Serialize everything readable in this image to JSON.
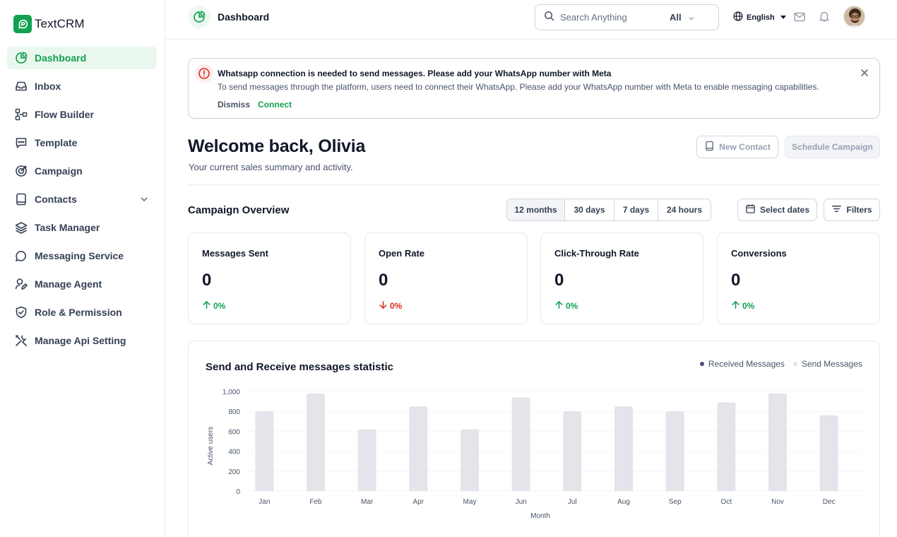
{
  "app": {
    "name": "TextCRM"
  },
  "sidebar": {
    "items": [
      {
        "label": "Dashboard",
        "icon": "dashboard-icon",
        "active": true
      },
      {
        "label": "Inbox",
        "icon": "inbox-icon"
      },
      {
        "label": "Flow Builder",
        "icon": "flow-builder-icon"
      },
      {
        "label": "Template",
        "icon": "template-icon"
      },
      {
        "label": "Campaign",
        "icon": "campaign-icon"
      },
      {
        "label": "Contacts",
        "icon": "contacts-icon",
        "expandable": true
      },
      {
        "label": "Task Manager",
        "icon": "task-manager-icon"
      },
      {
        "label": "Messaging Service",
        "icon": "messaging-service-icon"
      },
      {
        "label": "Manage Agent",
        "icon": "manage-agent-icon"
      },
      {
        "label": "Role & Permission",
        "icon": "role-permission-icon"
      },
      {
        "label": "Manage Api Setting",
        "icon": "api-setting-icon"
      }
    ]
  },
  "header": {
    "title": "Dashboard",
    "search_placeholder": "Search Anything",
    "search_scope": "All",
    "language": "English"
  },
  "alert": {
    "title": "Whatsapp connection is needed to send messages. Please add your WhatsApp number with Meta",
    "body": "To send messages through the platform, users need to connect their WhatsApp. Please add your WhatsApp number with Meta to enable messaging capabilities.",
    "dismiss_label": "Dismiss",
    "connect_label": "Connect"
  },
  "welcome": {
    "title": "Welcome back, Olivia",
    "subtitle": "Your current sales summary and activity.",
    "new_contact_label": "New Contact",
    "schedule_label": "Schedule Campaign"
  },
  "overview": {
    "title": "Campaign Overview",
    "ranges": [
      "12 months",
      "30 days",
      "7 days",
      "24 hours"
    ],
    "active_range": "12 months",
    "select_dates_label": "Select dates",
    "filters_label": "Filters",
    "stats": [
      {
        "label": "Messages Sent",
        "value": "0",
        "change": "0%",
        "trend": "up"
      },
      {
        "label": "Open Rate",
        "value": "0",
        "change": "0%",
        "trend": "down"
      },
      {
        "label": "Click-Through Rate",
        "value": "0",
        "change": "0%",
        "trend": "up"
      },
      {
        "label": "Conversions",
        "value": "0",
        "change": "0%",
        "trend": "up"
      }
    ]
  },
  "colors": {
    "brand": "#12a150",
    "up": "#12a150",
    "down": "#d92d20",
    "received_series": "#4b4a7a",
    "send_series": "#e3e5ea"
  },
  "chart_data": {
    "type": "bar",
    "title": "Send and Receive messages statistic",
    "xlabel": "Month",
    "ylabel": "Active users",
    "categories": [
      "Jan",
      "Feb",
      "Mar",
      "Apr",
      "May",
      "Jun",
      "Jul",
      "Aug",
      "Sep",
      "Oct",
      "Nov",
      "Dec"
    ],
    "yticks": [
      "0",
      "200",
      "400",
      "600",
      "800",
      "1,000"
    ],
    "ylim": [
      0,
      1000
    ],
    "grid": true,
    "legend_position": "top-right",
    "legend": [
      "Received Messages",
      "Send Messages"
    ],
    "series": [
      {
        "name": "Send Messages",
        "values": [
          800,
          980,
          620,
          850,
          620,
          940,
          800,
          850,
          800,
          890,
          980,
          760
        ]
      }
    ]
  }
}
